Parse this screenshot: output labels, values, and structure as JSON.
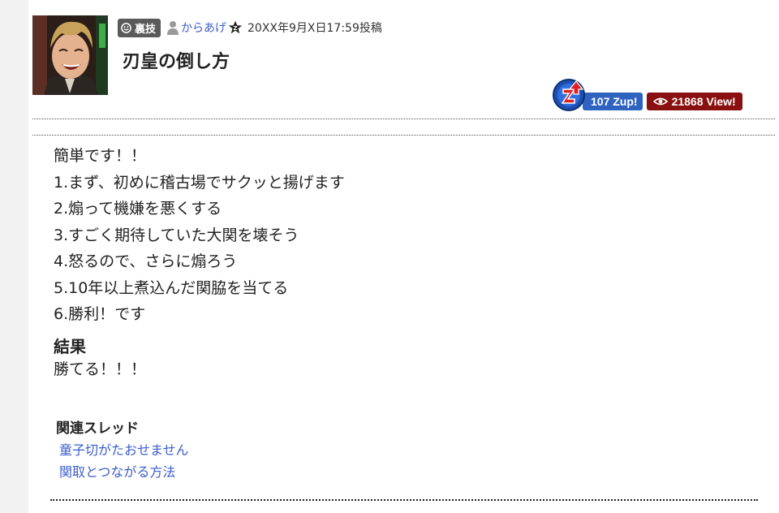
{
  "post": {
    "category": "裏技",
    "author": "からあげ",
    "posted_at": "20XX年9月X日17:59投稿",
    "title": "刃皇の倒し方"
  },
  "stats": {
    "zup": "107 Zup!",
    "views": "21868 View!"
  },
  "body_lines": [
    "簡単です！！",
    "1.まず、初めに稽古場でサクッと揚げます",
    "2.煽って機嫌を悪くする",
    "3.すごく期待していた大関を壊そう",
    "4.怒るので、さらに煽ろう",
    "5.10年以上煮込んだ関脇を当てる",
    "6.勝利！です"
  ],
  "result": {
    "heading": "結果",
    "text": "勝てる！！！"
  },
  "related": {
    "heading": "関連スレッド",
    "links": [
      "童子切がたおせません",
      "関取とつながる方法"
    ]
  },
  "colors": {
    "link": "#3b5ccc",
    "zup_blue": "#2f63c2",
    "view_red": "#8a0f0f",
    "category_gray": "#5a5a5a"
  },
  "icons": [
    "smile-icon",
    "user-icon",
    "rank-icon",
    "zup-logo-icon",
    "eye-icon"
  ]
}
